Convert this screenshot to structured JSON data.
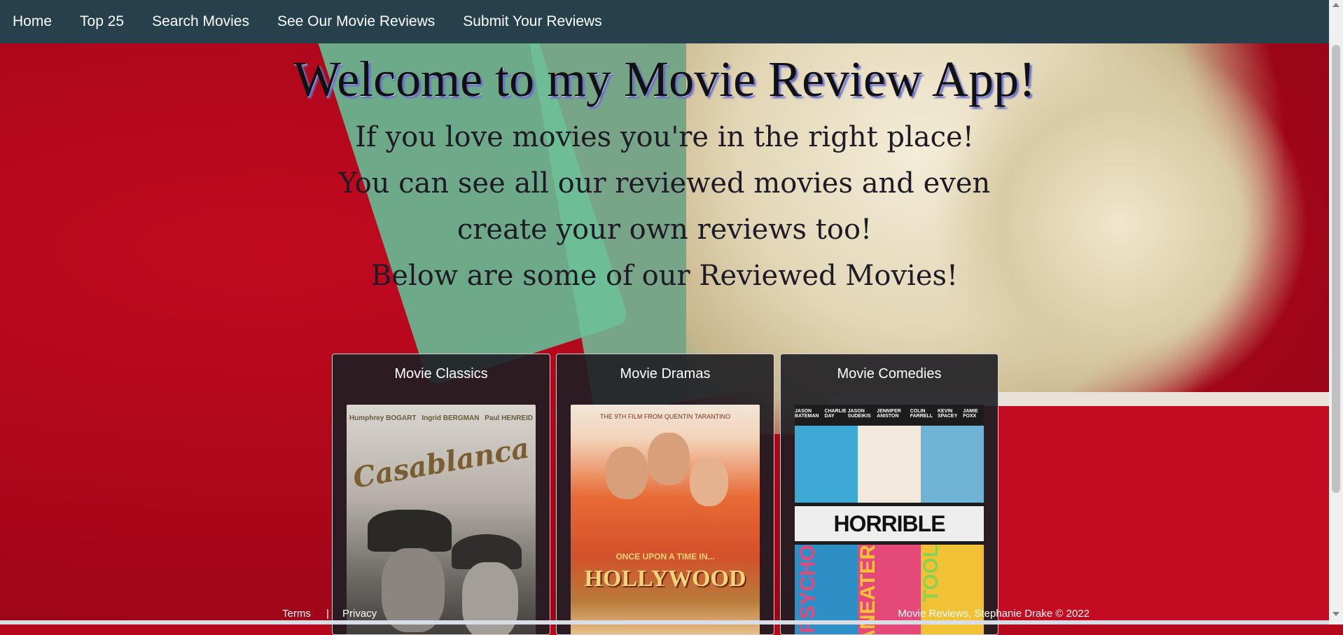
{
  "nav": {
    "items": [
      {
        "label": "Home"
      },
      {
        "label": "Top 25"
      },
      {
        "label": "Search Movies"
      },
      {
        "label": "See Our Movie Reviews"
      },
      {
        "label": "Submit Your Reviews"
      }
    ]
  },
  "hero": {
    "title": "Welcome to my Movie Review App!",
    "lines": [
      "If you love movies you're in the right place!",
      "You can see all our reviewed movies and even",
      "create your own reviews too!",
      "Below are some of our Reviewed Movies!"
    ]
  },
  "cards": [
    {
      "title": "Movie Classics",
      "poster": {
        "names": [
          "Humphrey BOGART",
          "Ingrid BERGMAN",
          "Paul HENREID"
        ],
        "title": "Casablanca"
      }
    },
    {
      "title": "Movie Dramas",
      "poster": {
        "tagline": "THE 9TH FILM FROM QUENTIN TARANTINO",
        "upper": "ONCE UPON A TIME IN...",
        "title": "HOLLYWOOD"
      }
    },
    {
      "title": "Movie Comedies",
      "poster": {
        "names": [
          "JASON BATEMAN",
          "CHARLIE DAY",
          "JASON SUDEIKIS",
          "JENNIFER ANISTON",
          "COLIN FARRELL",
          "KEVIN SPACEY",
          "JAMIE FOXX"
        ],
        "title": "HORRIBLE BOSSES",
        "words": [
          "PSYCHO",
          "MANEATER",
          "TOOL"
        ]
      }
    }
  ],
  "footer": {
    "terms": "Terms",
    "separator": "|",
    "privacy": "Privacy",
    "copyright": "Movie Reviews, Stephanie Drake © 2022"
  },
  "colors": {
    "navbar": "#26414c",
    "background": "#b5081c",
    "card": "#1e1e23"
  }
}
